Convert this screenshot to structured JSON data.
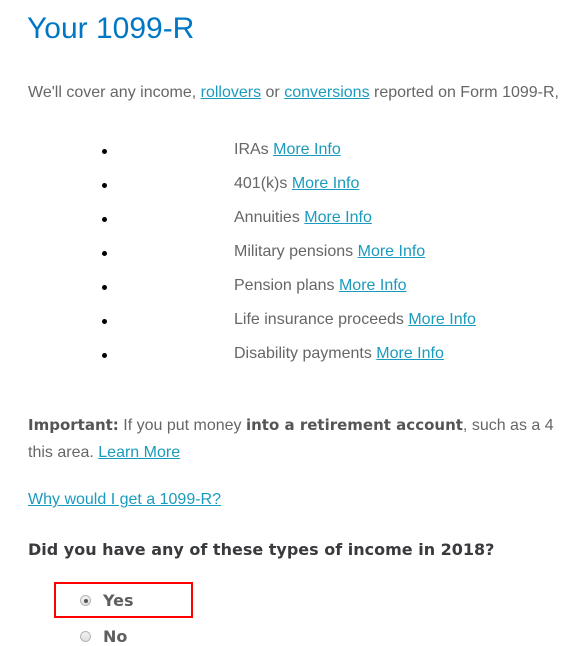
{
  "page": {
    "title": "Your 1099-R"
  },
  "intro": {
    "text_before": "We'll cover any income, ",
    "link_rollovers": "rollovers",
    "text_middle": " or ",
    "link_conversions": "conversions",
    "text_after": " reported on Form 1099-R,"
  },
  "income_types": [
    {
      "label": "IRAs",
      "link": "More Info"
    },
    {
      "label": "401(k)s",
      "link": "More Info"
    },
    {
      "label": "Annuities",
      "link": "More Info"
    },
    {
      "label": "Military pensions",
      "link": "More Info"
    },
    {
      "label": "Pension plans",
      "link": "More Info"
    },
    {
      "label": "Life insurance proceeds",
      "link": "More Info"
    },
    {
      "label": "Disability payments",
      "link": "More Info"
    }
  ],
  "important": {
    "label": "Important:",
    "text_1": " If you put money ",
    "bold_text": "into a retirement account",
    "text_2": ", such as a 4",
    "line2_text": "this area. ",
    "learn_more": "Learn More"
  },
  "why_link": "Why would I get a 1099-R?",
  "question": {
    "text": "Did you have any of these types of income in 2018?",
    "options": [
      {
        "label": "Yes",
        "selected": true
      },
      {
        "label": "No",
        "selected": false
      }
    ],
    "highlight_color": "#ff0000"
  },
  "colors": {
    "title": "#0077c5",
    "link": "#1a9bbd",
    "body_text": "#666666"
  }
}
